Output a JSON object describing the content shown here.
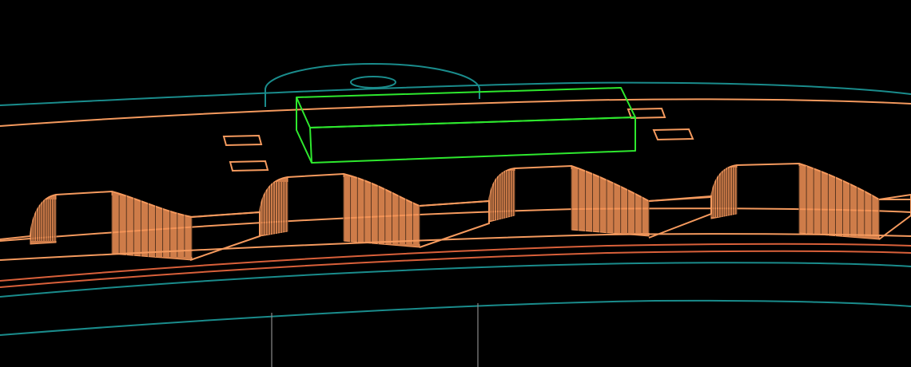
{
  "scene": {
    "background": "#000000",
    "colors": {
      "teal": "#1a8c8c",
      "orange": "#f59a5e",
      "dark_orange": "#d9603a",
      "green": "#2ee82e",
      "grey": "#8a8a8a"
    },
    "tooth_count": 4
  }
}
